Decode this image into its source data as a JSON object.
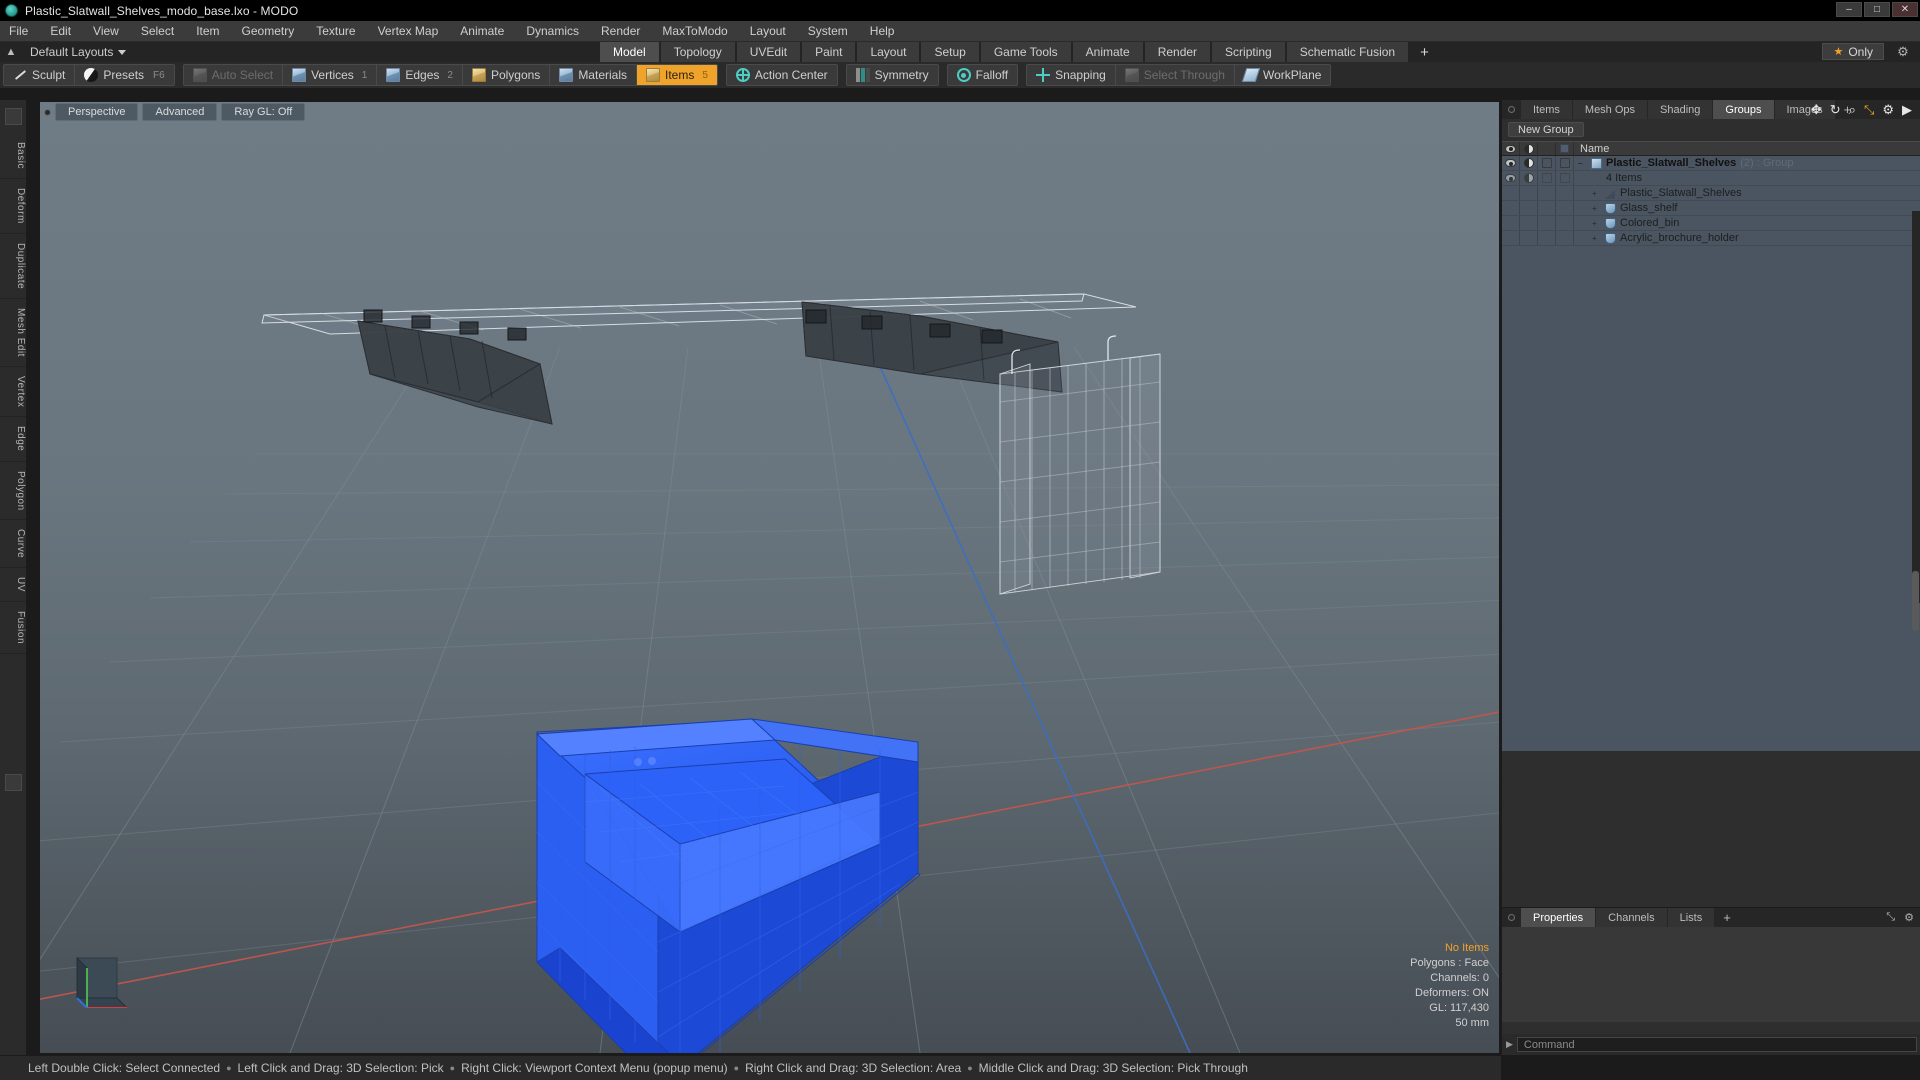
{
  "window": {
    "title": "Plastic_Slatwall_Shelves_modo_base.lxo - MODO",
    "app_icon": "modo-logo-icon",
    "minimize": "–",
    "maximize": "□",
    "close": "✕"
  },
  "menubar": {
    "items": [
      "File",
      "Edit",
      "View",
      "Select",
      "Item",
      "Geometry",
      "Texture",
      "Vertex Map",
      "Animate",
      "Dynamics",
      "Render",
      "MaxToModo",
      "Layout",
      "System",
      "Help"
    ]
  },
  "layoutbar": {
    "home_icon": "home-up-icon",
    "preset_label": "Default Layouts",
    "tabs": [
      {
        "label": "Model",
        "active": true
      },
      {
        "label": "Topology",
        "active": false
      },
      {
        "label": "UVEdit",
        "active": false
      },
      {
        "label": "Paint",
        "active": false
      },
      {
        "label": "Layout",
        "active": false
      },
      {
        "label": "Setup",
        "active": false
      },
      {
        "label": "Game Tools",
        "active": false
      },
      {
        "label": "Animate",
        "active": false
      },
      {
        "label": "Render",
        "active": false
      },
      {
        "label": "Scripting",
        "active": false
      },
      {
        "label": "Schematic Fusion",
        "active": false
      }
    ],
    "add_tab": "+",
    "only_label": "Only",
    "only_star": "★",
    "gear": "⚙"
  },
  "modebar": {
    "group1": [
      {
        "label": "Sculpt",
        "icon": "sculpt-brush-icon",
        "hint": "",
        "state": "normal"
      },
      {
        "label": "Presets",
        "icon": "preset-sphere-icon",
        "hint": "F6",
        "state": "normal"
      }
    ],
    "group2": [
      {
        "label": "Auto Select",
        "icon": "cube-grey-icon",
        "num": "",
        "state": "dim"
      },
      {
        "label": "Vertices",
        "icon": "cube-blue-icon",
        "num": "1",
        "state": "normal"
      },
      {
        "label": "Edges",
        "icon": "cube-blue-icon",
        "num": "2",
        "state": "normal"
      },
      {
        "label": "Polygons",
        "icon": "cube-blue-icon",
        "num": "",
        "state": "normal"
      },
      {
        "label": "Materials",
        "icon": "cube-blue-icon",
        "num": "",
        "state": "normal"
      },
      {
        "label": "Items",
        "icon": "cube-gold-icon",
        "num": "5",
        "state": "active"
      }
    ],
    "group3": [
      {
        "label": "Action Center",
        "icon": "crosshair-circle-icon",
        "state": "normal"
      },
      {
        "label": "Symmetry",
        "icon": "symmetry-bars-icon",
        "state": "normal"
      },
      {
        "label": "Falloff",
        "icon": "falloff-target-icon",
        "state": "normal"
      },
      {
        "label": "Snapping",
        "icon": "snap-cross-icon",
        "state": "normal"
      },
      {
        "label": "Select Through",
        "icon": "select-through-icon",
        "state": "dim"
      },
      {
        "label": "WorkPlane",
        "icon": "workplane-icon",
        "state": "normal"
      }
    ]
  },
  "left_strip": {
    "tabs": [
      "Basic",
      "Deform",
      "Duplicate",
      "Mesh Edit",
      "Vertex",
      "Edge",
      "Polygon",
      "Curve",
      "UV",
      "Fusion"
    ]
  },
  "viewport": {
    "header": {
      "dot": "viewport-menu-dot",
      "view_mode": "Perspective",
      "shading": "Advanced",
      "raygl": "Ray GL: Off"
    },
    "icons": [
      {
        "name": "pan-icon",
        "glyph": "✥"
      },
      {
        "name": "rotate-icon",
        "glyph": "↻"
      },
      {
        "name": "zoom-icon",
        "glyph": "⌕"
      },
      {
        "name": "fit-icon",
        "glyph": "⤡"
      },
      {
        "name": "gear-icon",
        "glyph": "⚙"
      },
      {
        "name": "expand-arrow-icon",
        "glyph": "▶"
      }
    ],
    "stats": {
      "items": "No Items",
      "polygons": "Polygons : Face",
      "channels": "Channels: 0",
      "deformers": "Deformers: ON",
      "gl": "GL: 117,430",
      "units": "50 mm"
    },
    "gizmo": {
      "x_color": "#e03a3a",
      "y_color": "#4caf50",
      "z_color": "#2f6fe0"
    },
    "grid_color": "#8a96a0",
    "x_axis_color": "#c2564d",
    "z_axis_color": "#3a6fc4",
    "selected_color": "#1f55ec"
  },
  "right_panel": {
    "tabs": [
      {
        "label": "Items",
        "active": false
      },
      {
        "label": "Mesh Ops",
        "active": false
      },
      {
        "label": "Shading",
        "active": false
      },
      {
        "label": "Groups",
        "active": true
      },
      {
        "label": "Images",
        "active": false
      },
      {
        "label": "+",
        "active": false
      }
    ],
    "new_group_button": "New Group",
    "tree_header": {
      "col_visible": "eye-icon",
      "col_render": "render-halfball-icon",
      "col_lock": "cube-outline-icon",
      "col_extra": "selection-square-icon",
      "name": "Name"
    },
    "tree": [
      {
        "label": "Plastic_Slatwall_Shelves",
        "suffix": "(2) : Group",
        "type": "group",
        "icon": "group-cube-icon",
        "indent": 0,
        "expander": "–"
      },
      {
        "label": "4 Items",
        "type": "count",
        "icon": "",
        "indent": 1,
        "expander": ""
      },
      {
        "label": "Plastic_Slatwall_Shelves",
        "type": "mesh",
        "icon": "mesh-icon",
        "indent": 1,
        "expander": "+"
      },
      {
        "label": "Glass_shelf",
        "type": "mesh",
        "icon": "shield-mesh-icon",
        "indent": 1,
        "expander": "+"
      },
      {
        "label": "Colored_bin",
        "type": "mesh",
        "icon": "shield-mesh-icon",
        "indent": 1,
        "expander": "+"
      },
      {
        "label": "Acrylic_brochure_holder",
        "type": "mesh",
        "icon": "shield-mesh-icon",
        "indent": 1,
        "expander": "+"
      }
    ],
    "properties": {
      "tabs": [
        {
          "label": "Properties",
          "active": true
        },
        {
          "label": "Channels",
          "active": false
        },
        {
          "label": "Lists",
          "active": false
        },
        {
          "label": "+",
          "active": false
        }
      ],
      "maximize_icon": "⤡",
      "gear_icon": "⚙"
    },
    "command": {
      "caret": "▶",
      "placeholder": "Command"
    }
  },
  "statusbar": {
    "hints": [
      "Left Double Click: Select Connected",
      "Left Click and Drag: 3D Selection: Pick",
      "Right Click: Viewport Context Menu (popup menu)",
      "Right Click and Drag: 3D Selection: Area",
      "Middle Click and Drag: 3D Selection: Pick Through"
    ],
    "separator": "●"
  }
}
